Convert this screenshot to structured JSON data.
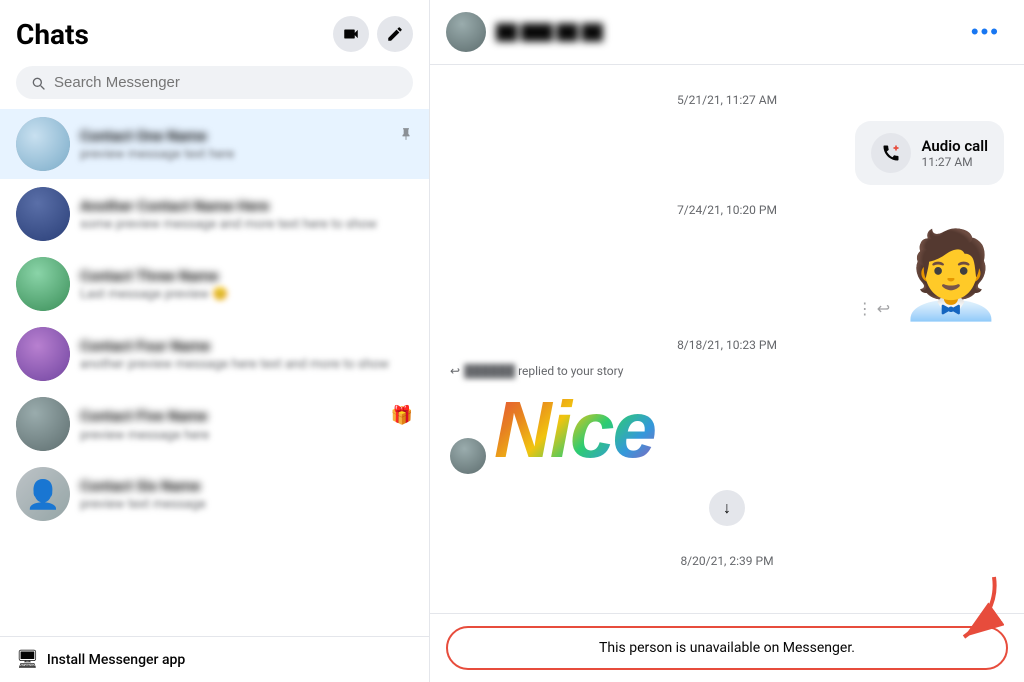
{
  "sidebar": {
    "title": "Chats",
    "search_placeholder": "Search Messenger",
    "footer_text": "Install Messenger app",
    "chats": [
      {
        "id": 1,
        "name": "Contact 1",
        "preview": "Preview text here",
        "avatar_class": "avatar-1",
        "active": true,
        "pin": true,
        "gift": false
      },
      {
        "id": 2,
        "name": "Contact 2 name",
        "preview": "Some preview message text here and more",
        "avatar_class": "avatar-2",
        "active": false,
        "pin": false,
        "gift": false
      },
      {
        "id": 3,
        "name": "Contact 3",
        "preview": "Last message preview",
        "avatar_class": "avatar-3",
        "active": false,
        "pin": false,
        "gift": false
      },
      {
        "id": 4,
        "name": "Contact 4",
        "preview": "Another preview message here and text",
        "avatar_class": "avatar-4",
        "active": false,
        "pin": false,
        "gift": false
      },
      {
        "id": 5,
        "name": "Contact 5",
        "preview": "Preview message",
        "avatar_class": "avatar-5",
        "active": false,
        "pin": false,
        "gift": true
      },
      {
        "id": 6,
        "name": "Contact 6",
        "preview": "Preview text",
        "avatar_class": "avatar-6",
        "active": false,
        "pin": false,
        "gift": false
      }
    ]
  },
  "chat": {
    "header_name": "██ ███ ██ ██",
    "timestamps": {
      "t1": "5/21/21, 11:27 AM",
      "t2": "7/24/21, 10:20 PM",
      "t3": "8/18/21, 10:23 PM",
      "t4": "8/20/21, 2:39 PM"
    },
    "audio_call_label": "Audio call",
    "audio_call_time": "11:27 AM",
    "replied_story": "replied to your story",
    "nice_text": "Nice",
    "unavailable_text": "This person is unavailable on Messenger."
  },
  "icons": {
    "video_call": "📹",
    "compose": "✏",
    "search": "🔍",
    "phone_off": "📵",
    "more": "•••",
    "pin": "📌",
    "gift": "🎁",
    "monitor": "🖥",
    "reply": "↩",
    "dots": "⋮",
    "down_arrow": "↓"
  }
}
